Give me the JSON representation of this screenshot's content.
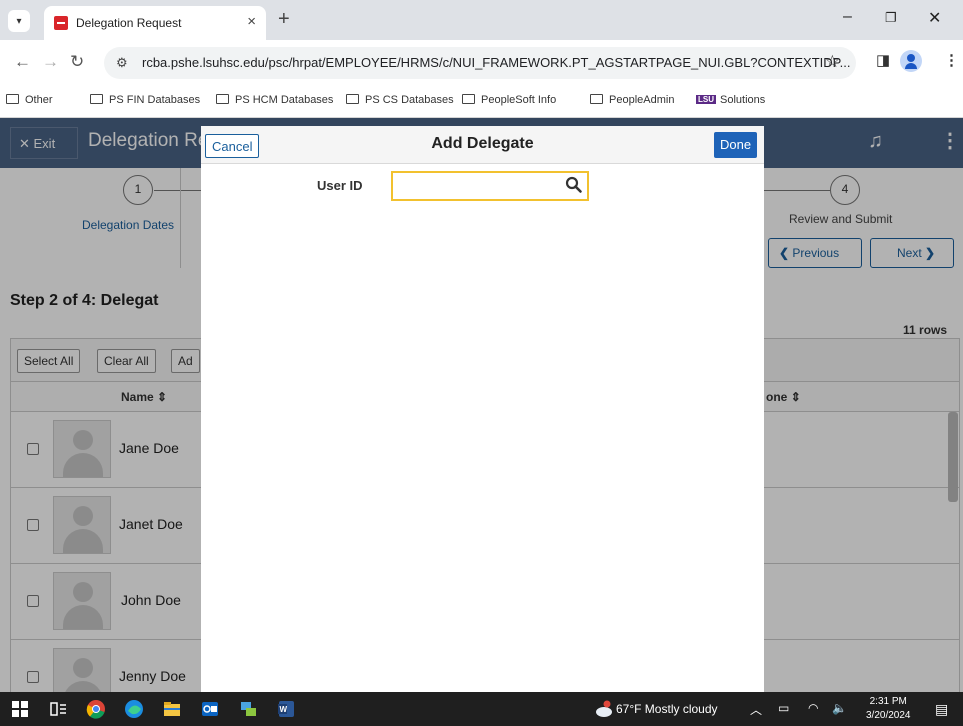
{
  "browser": {
    "tab_title": "Delegation Request",
    "url": "rcba.pshe.lsuhsc.edu/psc/hrpat/EMPLOYEE/HRMS/c/NUI_FRAMEWORK.PT_AGSTARTPAGE_NUI.GBL?CONTEXTIDP...",
    "bookmarks": [
      "Other",
      "PS FIN Databases",
      "PS HCM Databases",
      "PS CS Databases",
      "PeopleSoft Info",
      "PeopleAdmin",
      "Solutions"
    ]
  },
  "page": {
    "exit_label": "Exit",
    "title": "Delegation Re",
    "steps": [
      {
        "number": "1",
        "label": "Delegation Dates"
      },
      {
        "number": "4",
        "label": "Review and Submit"
      }
    ],
    "previous_label": "Previous",
    "next_label": "Next",
    "section_title": "Step 2 of 4: Delegat",
    "rows_count": "11 rows",
    "grid_buttons": [
      "Select All",
      "Clear All",
      "Ad"
    ],
    "columns": [
      "Name",
      "one"
    ],
    "rows": [
      "Jane Doe",
      "Janet Doe",
      "John Doe",
      "Jenny Doe"
    ]
  },
  "modal": {
    "cancel_label": "Cancel",
    "title": "Add Delegate",
    "done_label": "Done",
    "user_id_label": "User ID",
    "user_id_value": ""
  },
  "taskbar": {
    "weather": "67°F  Mostly cloudy",
    "time": "2:31 PM",
    "date": "3/20/2024"
  },
  "colors": {
    "header_bg": "#4a6386",
    "primary_button": "#1e63b8",
    "focus_border": "#f2c12e",
    "link_blue": "#1a5f9c"
  }
}
